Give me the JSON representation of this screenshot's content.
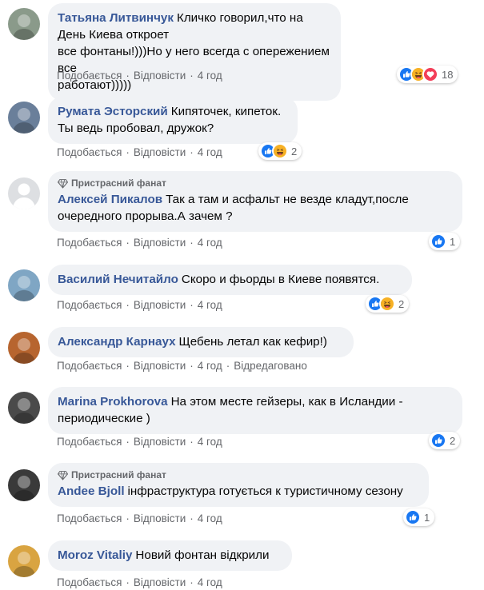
{
  "comments": [
    {
      "author": "Татьяна Литвинчук",
      "badge": "",
      "lines": [
        "Кличко говорил,что на День Киева откроет",
        "все фонтаны!)))Но у него всегда с опережением все",
        "работают)))))"
      ],
      "actions": {
        "like": "Подобається",
        "reply": "Відповісти",
        "time": "4 год",
        "edited": ""
      },
      "reactions": {
        "icons": [
          "like",
          "haha",
          "love"
        ],
        "count": "18"
      },
      "avatar_color": "#8a9a8a"
    },
    {
      "author": "Румата Эсторский",
      "badge": "",
      "lines": [
        "Кипяточек, кипеток.",
        "Ты ведь пробовал, дружок?"
      ],
      "actions": {
        "like": "Подобається",
        "reply": "Відповісти",
        "time": "4 год",
        "edited": ""
      },
      "reactions": {
        "icons": [
          "like",
          "haha"
        ],
        "count": "2"
      },
      "avatar_color": "#6a7f9a"
    },
    {
      "author": "Алексей Пикалов",
      "badge": "Пристрасний фанат",
      "lines": [
        "Так а там и асфальт не везде кладут,после",
        "очередного прорыва.А зачем ?"
      ],
      "actions": {
        "like": "Подобається",
        "reply": "Відповісти",
        "time": "4 год",
        "edited": ""
      },
      "reactions": {
        "icons": [
          "like"
        ],
        "count": "1"
      },
      "avatar_color": "#c9ccd1"
    },
    {
      "author": "Василий Нечитайло",
      "badge": "",
      "lines": [
        "Скоро и фьорды в Киеве появятся."
      ],
      "actions": {
        "like": "Подобається",
        "reply": "Відповісти",
        "time": "4 год",
        "edited": ""
      },
      "reactions": {
        "icons": [
          "like",
          "haha"
        ],
        "count": "2"
      },
      "avatar_color": "#7fa6c4"
    },
    {
      "author": "Александр Карнаух",
      "badge": "",
      "lines": [
        "Щебень летал как кефир!)"
      ],
      "actions": {
        "like": "Подобається",
        "reply": "Відповісти",
        "time": "4 год",
        "edited": "Відредаговано"
      },
      "reactions": {
        "icons": [],
        "count": ""
      },
      "avatar_color": "#b7652f"
    },
    {
      "author": "Marina Prokhorova",
      "badge": "",
      "lines": [
        "На этом месте гейзеры, как в Исландии -",
        "периодические )"
      ],
      "actions": {
        "like": "Подобається",
        "reply": "Відповісти",
        "time": "4 год",
        "edited": ""
      },
      "reactions": {
        "icons": [
          "like"
        ],
        "count": "2"
      },
      "avatar_color": "#4a4a4a"
    },
    {
      "author": "Andee Bjoll",
      "badge": "Пристрасний фанат",
      "lines": [
        "інфраструктура готується к туристичному сезону"
      ],
      "actions": {
        "like": "Подобається",
        "reply": "Відповісти",
        "time": "4 год",
        "edited": ""
      },
      "reactions": {
        "icons": [
          "like"
        ],
        "count": "1"
      },
      "avatar_color": "#3a3a3a"
    },
    {
      "author": "Moroz Vitaliy",
      "badge": "",
      "lines": [
        "Новий фонтан відкрили"
      ],
      "actions": {
        "like": "Подобається",
        "reply": "Відповісти",
        "time": "4 год",
        "edited": ""
      },
      "reactions": {
        "icons": [],
        "count": ""
      },
      "avatar_color": "#d9a441"
    }
  ],
  "colors": {
    "author": "#385898",
    "meta": "#65676b",
    "bubble": "#f0f2f5",
    "like": "#1877f2",
    "haha": "#f7b125",
    "love": "#f33e58"
  }
}
